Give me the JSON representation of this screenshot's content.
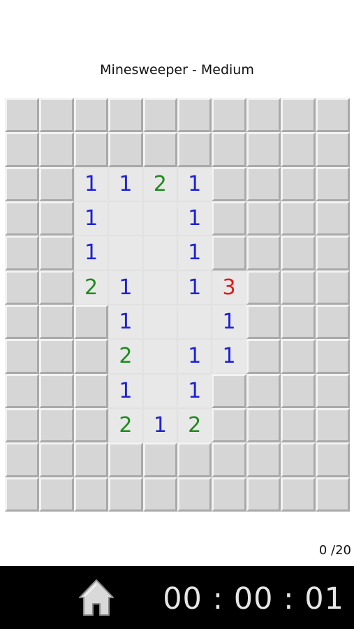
{
  "title": "Minesweeper - Medium",
  "counter": "0 /20",
  "timer": "00 : 00 : 01",
  "icons": {
    "home": "home-icon"
  },
  "colors": {
    "1": "#1e22d4",
    "2": "#1f8a1f",
    "3": "#e01b1b"
  },
  "board": {
    "rows": 12,
    "cols": 10,
    "cells": [
      [
        "#",
        "#",
        "#",
        "#",
        "#",
        "#",
        "#",
        "#",
        "#",
        "#"
      ],
      [
        "#",
        "#",
        "#",
        "#",
        "#",
        "#",
        "#",
        "#",
        "#",
        "#"
      ],
      [
        "#",
        "#",
        "1",
        "1",
        "2",
        "1",
        "#",
        "#",
        "#",
        "#"
      ],
      [
        "#",
        "#",
        "1",
        "",
        "",
        "1",
        "#",
        "#",
        "#",
        "#"
      ],
      [
        "#",
        "#",
        "1",
        "",
        "",
        "1",
        "#",
        "#",
        "#",
        "#"
      ],
      [
        "#",
        "#",
        "2",
        "1",
        "",
        "1",
        "3",
        "#",
        "#",
        "#"
      ],
      [
        "#",
        "#",
        "#",
        "1",
        "",
        "",
        "1",
        "#",
        "#",
        "#"
      ],
      [
        "#",
        "#",
        "#",
        "2",
        "",
        "1",
        "1",
        "#",
        "#",
        "#"
      ],
      [
        "#",
        "#",
        "#",
        "1",
        "",
        "1",
        "#",
        "#",
        "#",
        "#"
      ],
      [
        "#",
        "#",
        "#",
        "2",
        "1",
        "2",
        "#",
        "#",
        "#",
        "#"
      ],
      [
        "#",
        "#",
        "#",
        "#",
        "#",
        "#",
        "#",
        "#",
        "#",
        "#"
      ],
      [
        "#",
        "#",
        "#",
        "#",
        "#",
        "#",
        "#",
        "#",
        "#",
        "#"
      ]
    ]
  }
}
